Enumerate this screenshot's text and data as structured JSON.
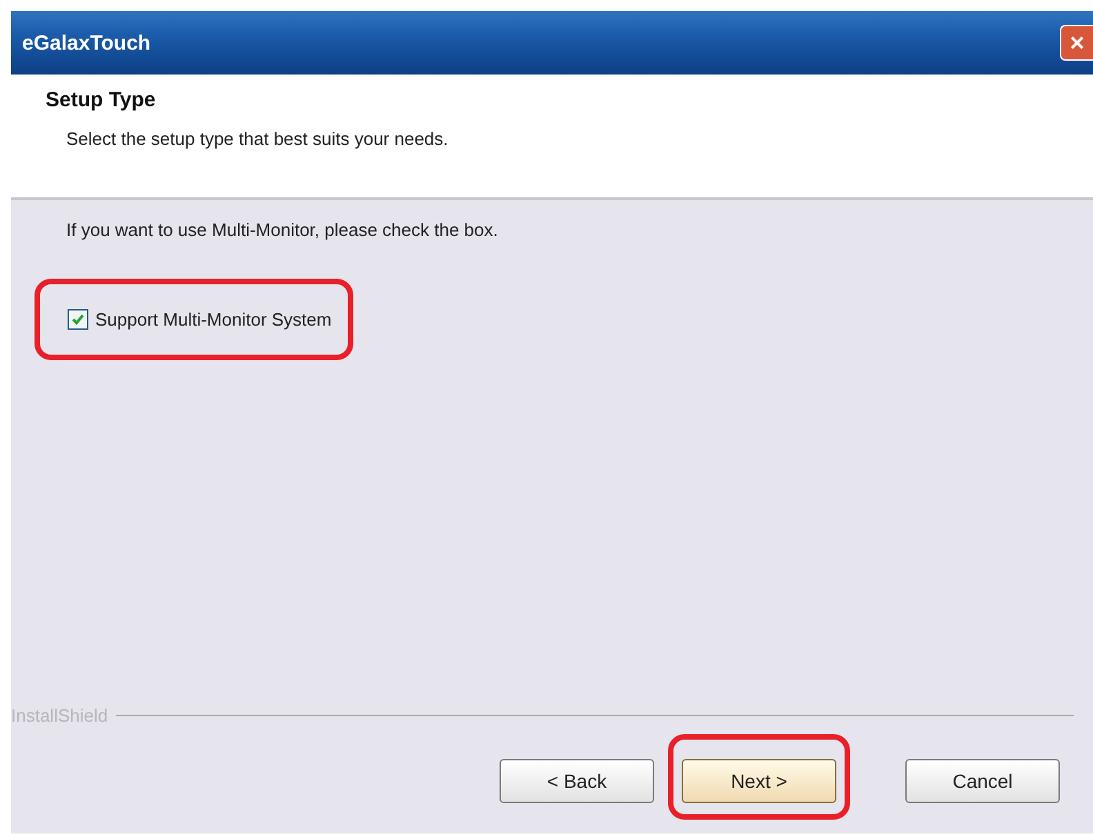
{
  "window": {
    "title": "eGalaxTouch",
    "close": "×"
  },
  "header": {
    "title": "Setup Type",
    "subtitle": "Select the setup type that best suits your needs."
  },
  "body": {
    "instruction": "If you want to use Multi-Monitor, please check the box.",
    "checkbox": {
      "label": "Support Multi-Monitor System",
      "checked": true,
      "highlighted": true
    }
  },
  "footer": {
    "brand": "InstallShield"
  },
  "buttons": [
    {
      "label": "< Back",
      "default": false,
      "highlighted": false
    },
    {
      "label": "Next >",
      "default": true,
      "highlighted": true
    },
    {
      "label": "Cancel",
      "default": false,
      "highlighted": false
    }
  ]
}
